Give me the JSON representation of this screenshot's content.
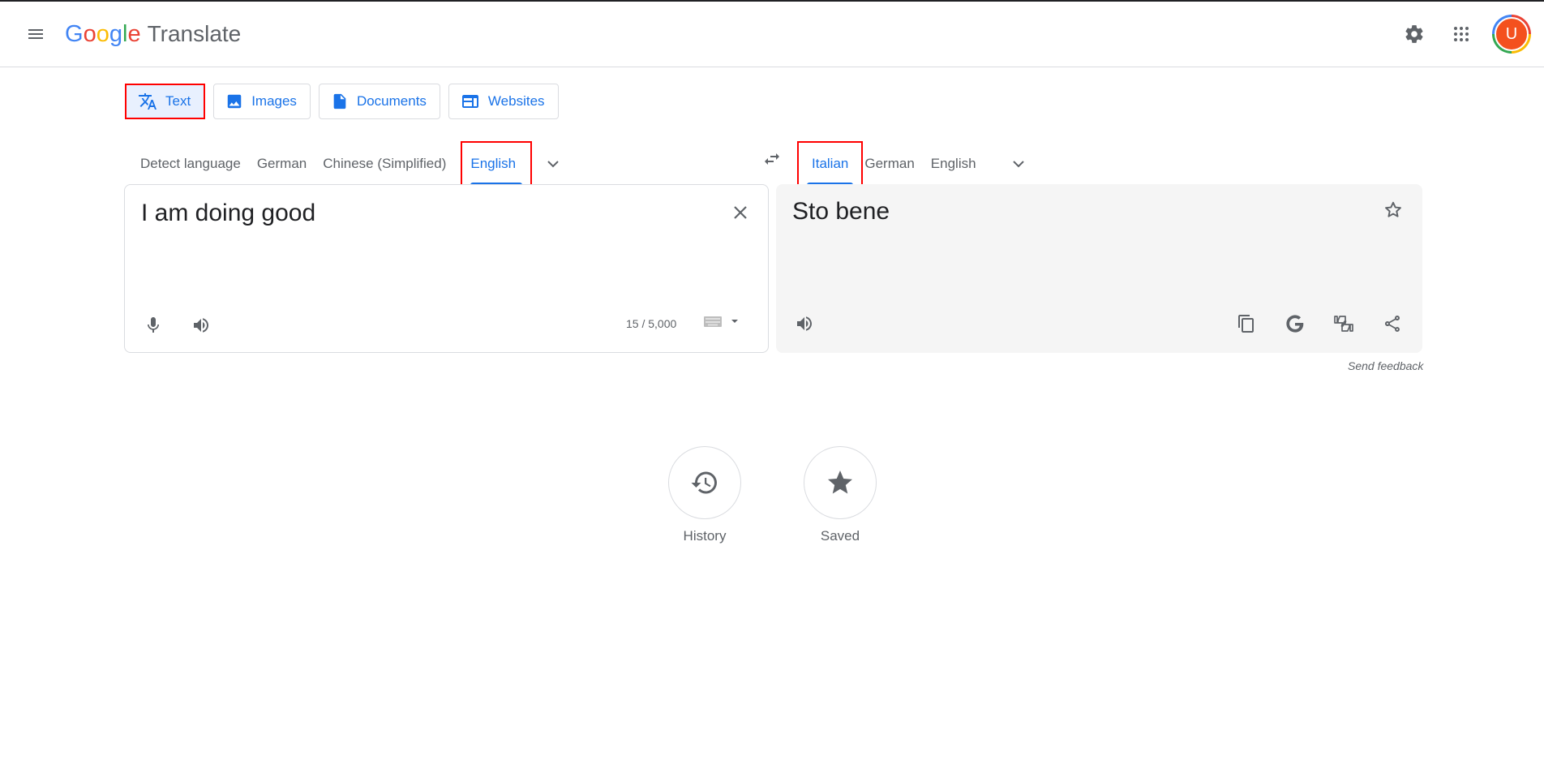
{
  "header": {
    "logo_letters": [
      "G",
      "o",
      "o",
      "g",
      "l",
      "e"
    ],
    "logo_colors": [
      "#4285f4",
      "#ea4335",
      "#fbbc04",
      "#4285f4",
      "#34a853",
      "#ea4335"
    ],
    "product": "Translate",
    "avatar_initial": "U"
  },
  "mode_tabs": [
    {
      "label": "Text",
      "icon": "translate-icon",
      "active": true
    },
    {
      "label": "Images",
      "icon": "image-icon",
      "active": false
    },
    {
      "label": "Documents",
      "icon": "document-icon",
      "active": false
    },
    {
      "label": "Websites",
      "icon": "website-icon",
      "active": false
    }
  ],
  "source_languages": [
    "Detect language",
    "German",
    "Chinese (Simplified)",
    "English"
  ],
  "source_selected": "English",
  "target_languages": [
    "Italian",
    "German",
    "English"
  ],
  "target_selected": "Italian",
  "source": {
    "text": "I am doing good",
    "char_count": "15 / 5,000"
  },
  "target": {
    "text": "Sto bene"
  },
  "feedback_label": "Send feedback",
  "history_label": "History",
  "saved_label": "Saved",
  "colors": {
    "accent": "#1a73e8",
    "highlight_box": "#ff0000"
  }
}
